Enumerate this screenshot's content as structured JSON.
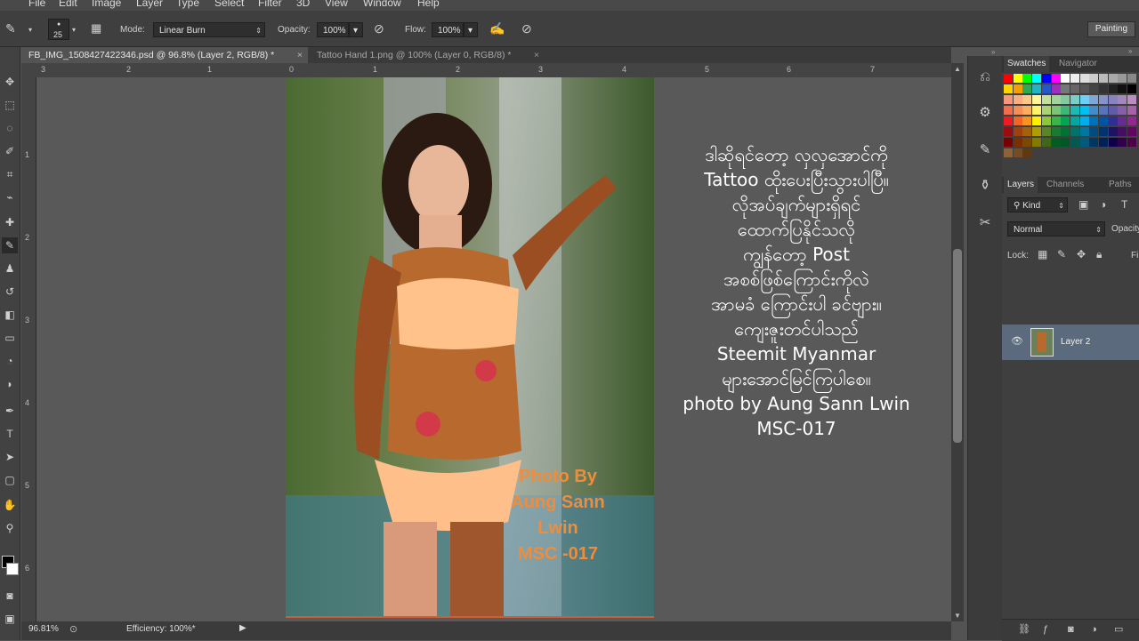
{
  "menu": [
    "File",
    "Edit",
    "Image",
    "Layer",
    "Type",
    "Select",
    "Filter",
    "3D",
    "View",
    "Window",
    "Help"
  ],
  "options": {
    "brush_size": "25",
    "mode_label": "Mode:",
    "mode_value": "Linear Burn",
    "opacity_label": "Opacity:",
    "opacity_value": "100%",
    "flow_label": "Flow:",
    "flow_value": "100%",
    "workspace": "Painting"
  },
  "tabs": [
    {
      "label": "FB_IMG_1508427422346.psd @ 96.8% (Layer 2, RGB/8) *",
      "active": true
    },
    {
      "label": "Tattoo Hand 1.png @ 100% (Layer 0, RGB/8) *",
      "active": false
    }
  ],
  "ruler": {
    "h": [
      "3",
      "2",
      "1",
      "0",
      "1",
      "2",
      "3",
      "4",
      "5",
      "6",
      "7"
    ],
    "v": [
      "1",
      "2",
      "3",
      "4",
      "5",
      "6"
    ]
  },
  "canvas": {
    "caption_lines": [
      "ဒါဆိုရင်တော့ လှလှအောင်ကို",
      "Tattoo ထိုးပေးပြီးသွားပါပြီ။",
      "လိုအပ်ချက်များရှိရင်",
      "ထောက်ပြနိုင်သလို",
      "ကျွန်တော့ Post",
      "အစစ်ဖြစ်ကြောင်းကိုလဲ",
      "အာမခံ ကြောင်းပါ ခင်ဗျား။",
      "ကျေးဇူးတင်ပါသည်",
      "Steemit Myanmar",
      "များအောင်မြင်ကြပါစေ။",
      "photo by Aung Sann Lwin",
      "MSC-017"
    ],
    "watermark_lines": [
      "Photo By",
      "Aung Sann",
      "Lwin",
      "MSC -017"
    ]
  },
  "status": {
    "zoom": "96.81%",
    "efficiency": "Efficiency: 100%*"
  },
  "panels": {
    "top_tabs": [
      "Swatches",
      "Navigator"
    ],
    "layers_tabs": [
      "Layers",
      "Channels",
      "Paths"
    ],
    "kind_label": "Kind",
    "blend_mode": "Normal",
    "opacity_label": "Opacity",
    "lock_label": "Lock:",
    "fill_label": "Fi",
    "layer_name": "Layer 2"
  },
  "colors": {
    "accent_selected_layer": "#5b6b7d",
    "watermark": "#f08c3a",
    "caption": "#ffffff"
  }
}
